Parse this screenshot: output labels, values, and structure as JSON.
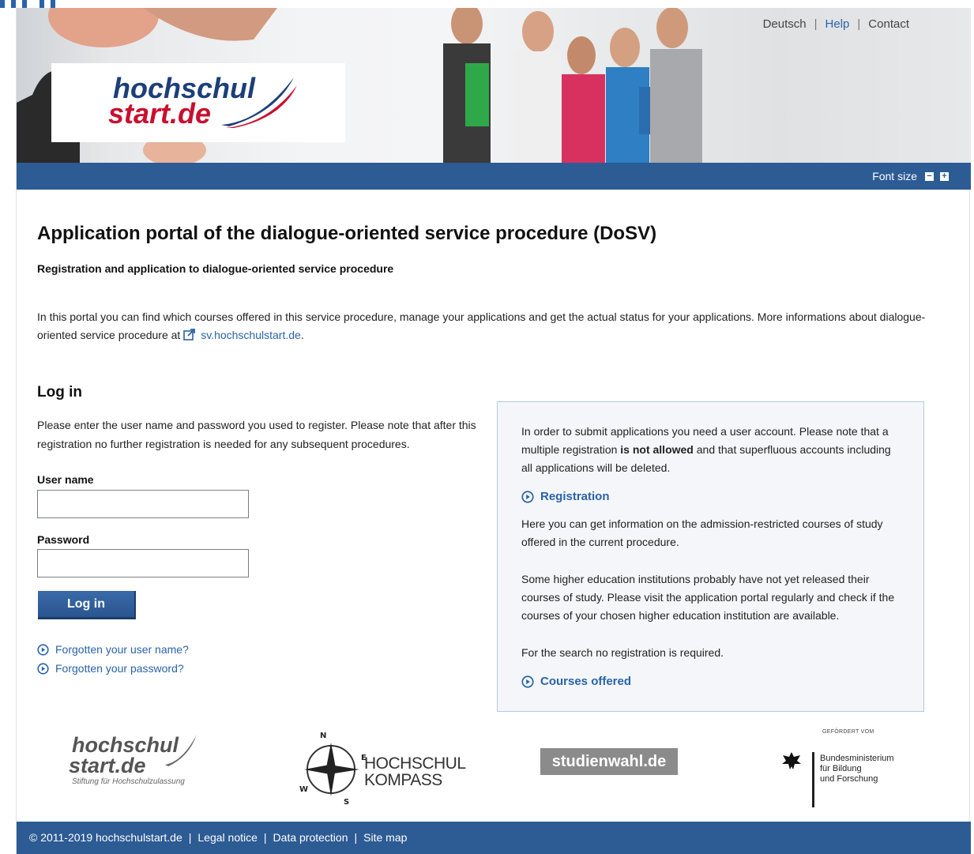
{
  "header": {
    "logo": {
      "line1": "hochschul",
      "line2": "start.de"
    },
    "top_links": [
      {
        "label": "Deutsch"
      },
      {
        "label": "Help"
      },
      {
        "label": "Contact"
      }
    ]
  },
  "toolbar": {
    "font_size_label": "Font size",
    "decrease": "−",
    "increase": "+"
  },
  "main": {
    "title": "Application portal of the dialogue-oriented service procedure (DoSV)",
    "subtitle": "Registration and application to dialogue-oriented service procedure",
    "intro_text": "In this portal you can find which courses offered in this service procedure, manage your applications and get the actual status for your applications. More informations about dialogue-oriented service procedure at",
    "intro_link": "sv.hochschulstart.de",
    "intro_end": "."
  },
  "login": {
    "heading": "Log in",
    "note": "Please enter the user name and password you used to register. Please note that after this registration no further registration is needed for any subsequent procedures.",
    "username_label": "User name",
    "username_value": "",
    "password_label": "Password",
    "password_value": "",
    "button": "Log in",
    "forgot_user": "Forgotten your user name?",
    "forgot_password": "Forgotten your password?"
  },
  "infobox": {
    "p1_before": "In order to submit applications you need a user account. Please note that a multiple registration",
    "p1_bold": "is not allowed",
    "p1_after": "and that superfluous accounts including all applications will be deleted.",
    "registration_link": "Registration",
    "p2": "Here you can get information on the admission-restricted courses of study offered in the current procedure.",
    "p3": "Some higher education institutions probably have not yet released their courses of study. Please visit the application portal regularly and check if the courses of your chosen higher education institution are available.",
    "p4": "For the search no registration is required.",
    "courses_link": "Courses offered"
  },
  "partners": {
    "hs_line1": "hochschul",
    "hs_line2": "start.de",
    "hs_tagline": "Stiftung für Hochschulzulassung",
    "kompass_line1": "HOCHSCHUL",
    "kompass_line2": "KOMPASS",
    "studienwahl": "studienwahl.de",
    "bmbf_head": "GEFÖRDERT VOM",
    "bmbf_line1": "Bundesministerium",
    "bmbf_line2": "für Bildung",
    "bmbf_line3": "und Forschung"
  },
  "footer": {
    "copyright": "© 2011-2019 hochschulstart.de",
    "links": [
      "Legal notice",
      "Data protection",
      "Site map"
    ]
  },
  "colors": {
    "brand_blue": "#2d5b94",
    "link_blue": "#2a63a8",
    "logo_red": "#c8102e"
  }
}
